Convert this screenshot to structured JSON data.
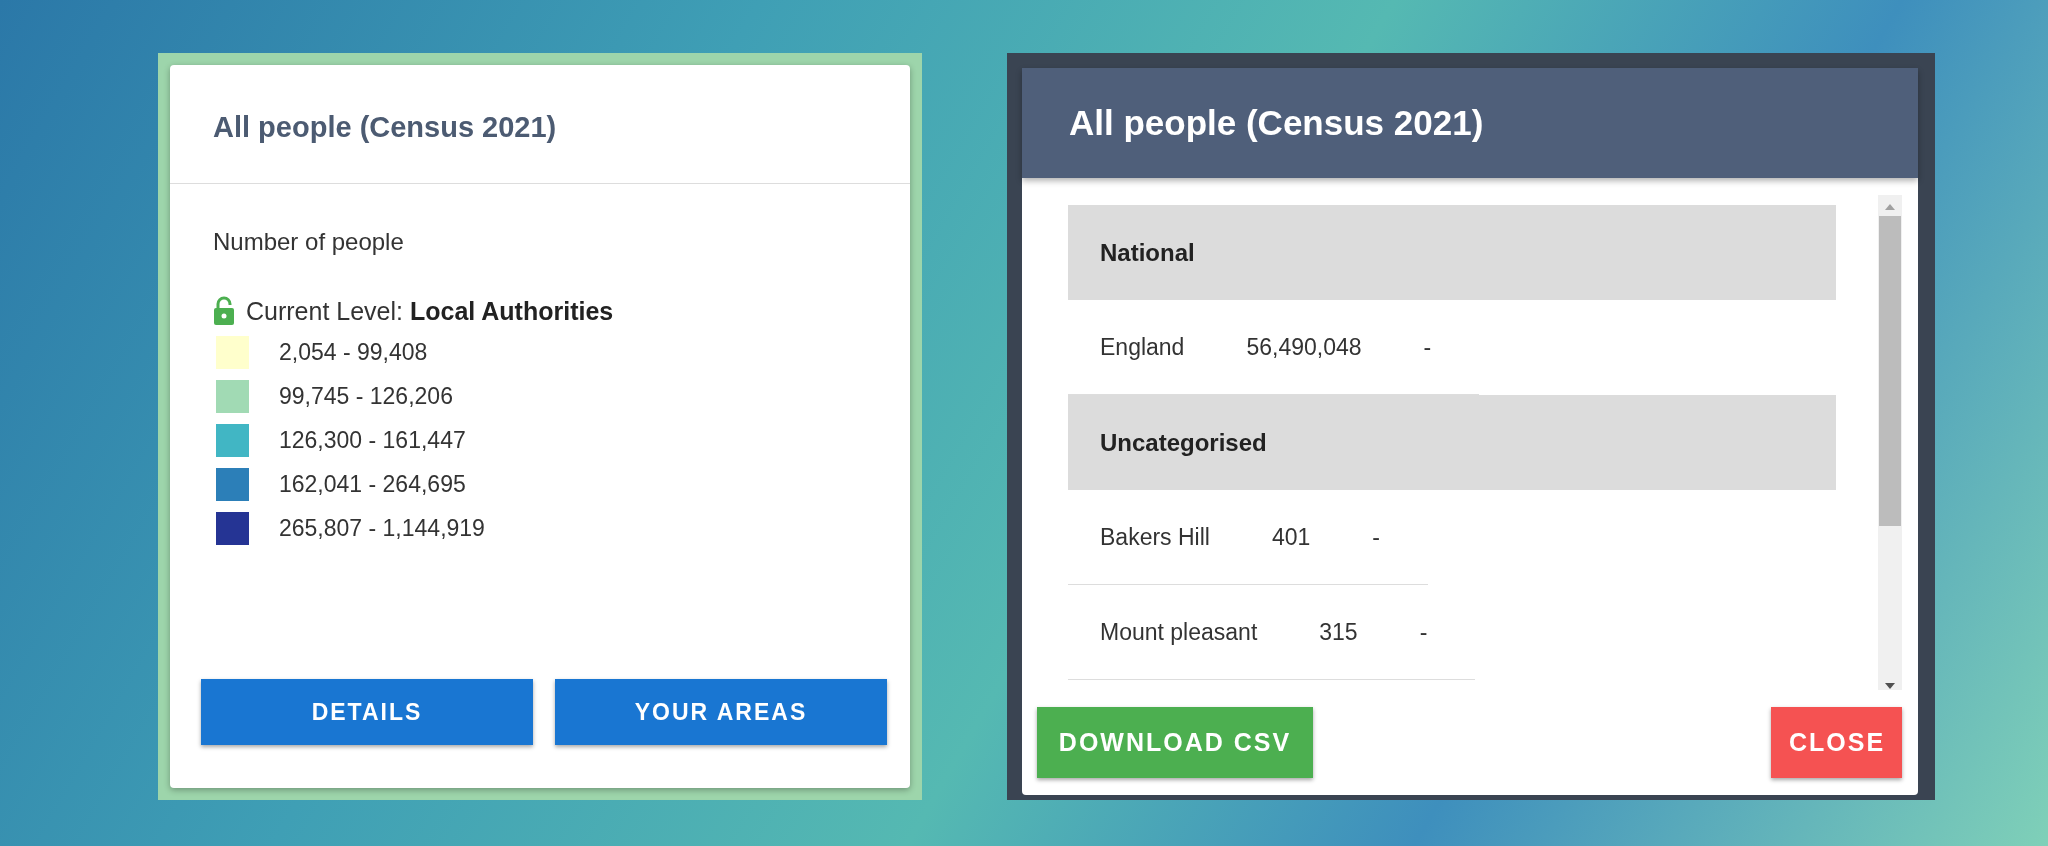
{
  "legend_panel": {
    "title": "All people (Census 2021)",
    "measure": "Number of people",
    "level_label": "Current Level: ",
    "level_value": "Local Authorities",
    "legend": [
      {
        "range": "2,054 - 99,408",
        "color": "#ffffcc"
      },
      {
        "range": "99,745 - 126,206",
        "color": "#a1dab4"
      },
      {
        "range": "126,300 - 161,447",
        "color": "#41b6c4"
      },
      {
        "range": "162,041 - 264,695",
        "color": "#2c7fb8"
      },
      {
        "range": "265,807 - 1,144,919",
        "color": "#253494"
      }
    ],
    "buttons": [
      "DETAILS",
      "YOUR AREAS"
    ]
  },
  "data_dialog": {
    "title": "All people (Census 2021)",
    "sections": [
      {
        "heading": "National",
        "rows": [
          {
            "name": "England",
            "value": "56,490,048",
            "change": "-"
          }
        ]
      },
      {
        "heading": "Uncategorised",
        "rows": [
          {
            "name": "Bakers Hill",
            "value": "401",
            "change": "-"
          },
          {
            "name": "Mount pleasant",
            "value": "315",
            "change": "-"
          }
        ]
      }
    ],
    "buttons": [
      {
        "label": "DOWNLOAD CSV",
        "kind": "primary"
      },
      {
        "label": "CLOSE",
        "kind": "danger"
      }
    ]
  }
}
